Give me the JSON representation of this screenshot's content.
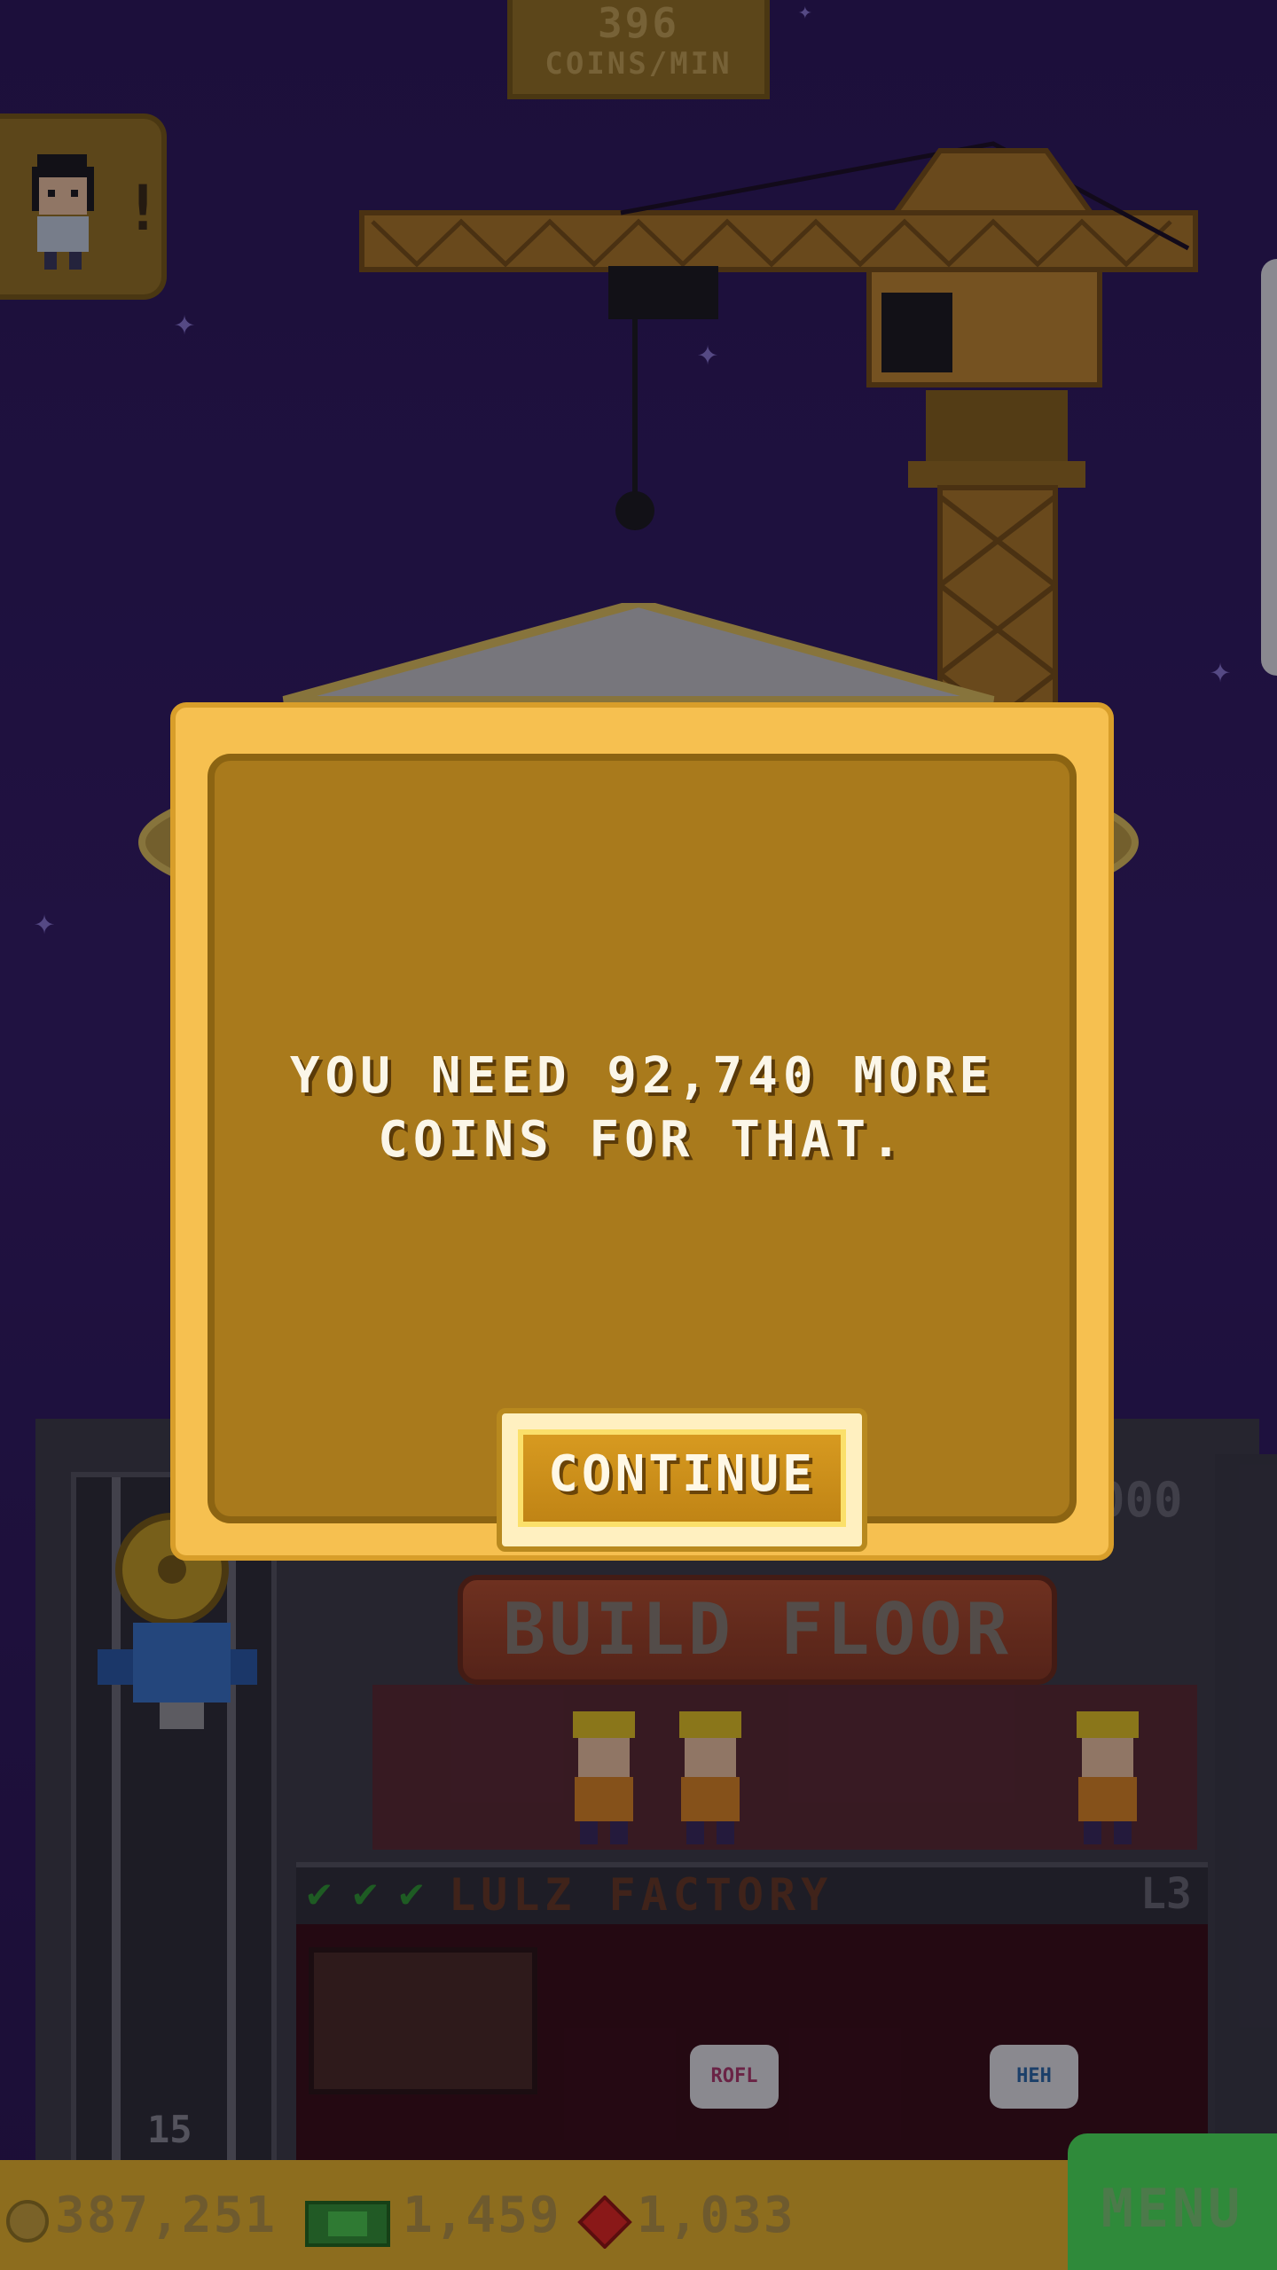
{
  "hud": {
    "coins_per_min_value": "396",
    "coins_per_min_unit": "COINS/MIN",
    "visitor_alert": "!"
  },
  "build": {
    "button_label": "BUILD FLOOR",
    "elevator_floor": "15",
    "partial_number": "000"
  },
  "floor": {
    "name": "LULZ FACTORY",
    "level": "L3",
    "checks": 3,
    "bubbles": [
      "ROFL",
      "HEH"
    ]
  },
  "bottom_bar": {
    "coins": "387,251",
    "bux": "1,459",
    "gems": "1,033",
    "menu_label": "MENU"
  },
  "dialog": {
    "message_line1": "YOU NEED 92,740 MORE",
    "message_line2": "COINS FOR THAT.",
    "continue_label": "CONTINUE"
  },
  "icons": {
    "coin": "coin-icon",
    "bux": "bux-icon",
    "gem": "gem-icon",
    "check": "check-icon"
  }
}
